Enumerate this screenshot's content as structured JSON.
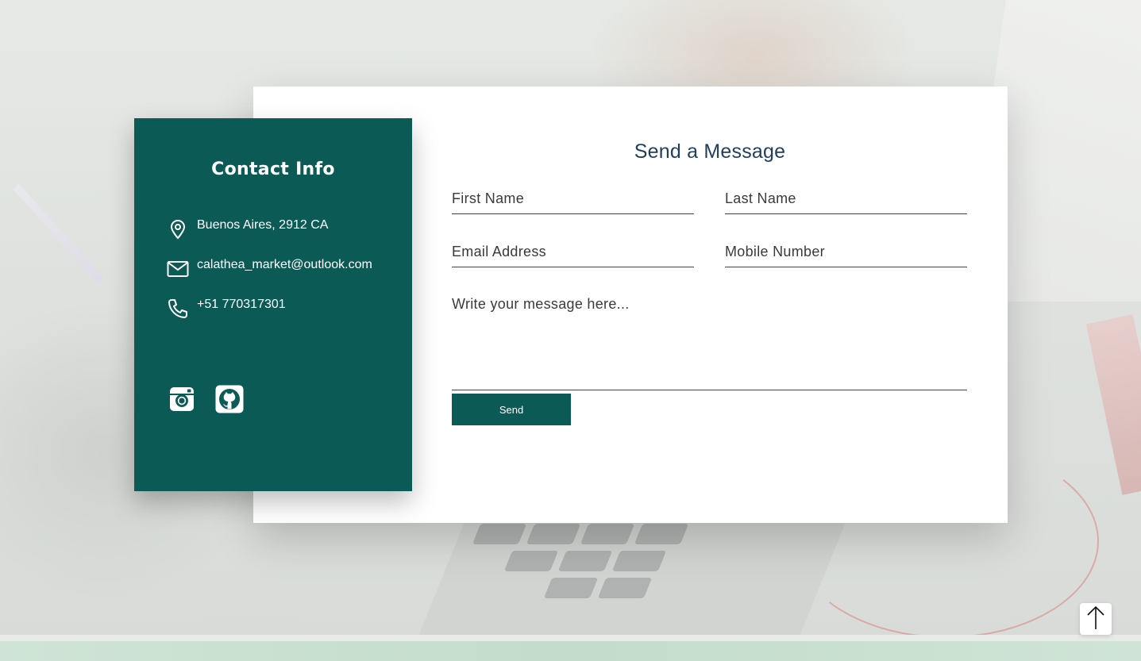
{
  "contact_info": {
    "title": "Contact Info",
    "items": [
      {
        "icon": "location-pin-icon",
        "text": "Buenos Aires, 2912 CA"
      },
      {
        "icon": "mail-icon",
        "text": "calathea_market@outlook.com"
      },
      {
        "icon": "phone-icon",
        "text": "+51 770317301"
      }
    ],
    "social": [
      {
        "icon": "instagram-icon"
      },
      {
        "icon": "github-icon"
      }
    ]
  },
  "form": {
    "title": "Send a Message",
    "first_name_placeholder": "First Name",
    "last_name_placeholder": "Last Name",
    "email_placeholder": "Email Address",
    "mobile_placeholder": "Mobile Number",
    "message_placeholder": "Write your message here...",
    "send_label": "Send"
  },
  "colors": {
    "accent": "#0b5a56",
    "title_text": "#1f3f5c"
  },
  "scroll_top": {
    "icon": "arrow-up-icon"
  }
}
